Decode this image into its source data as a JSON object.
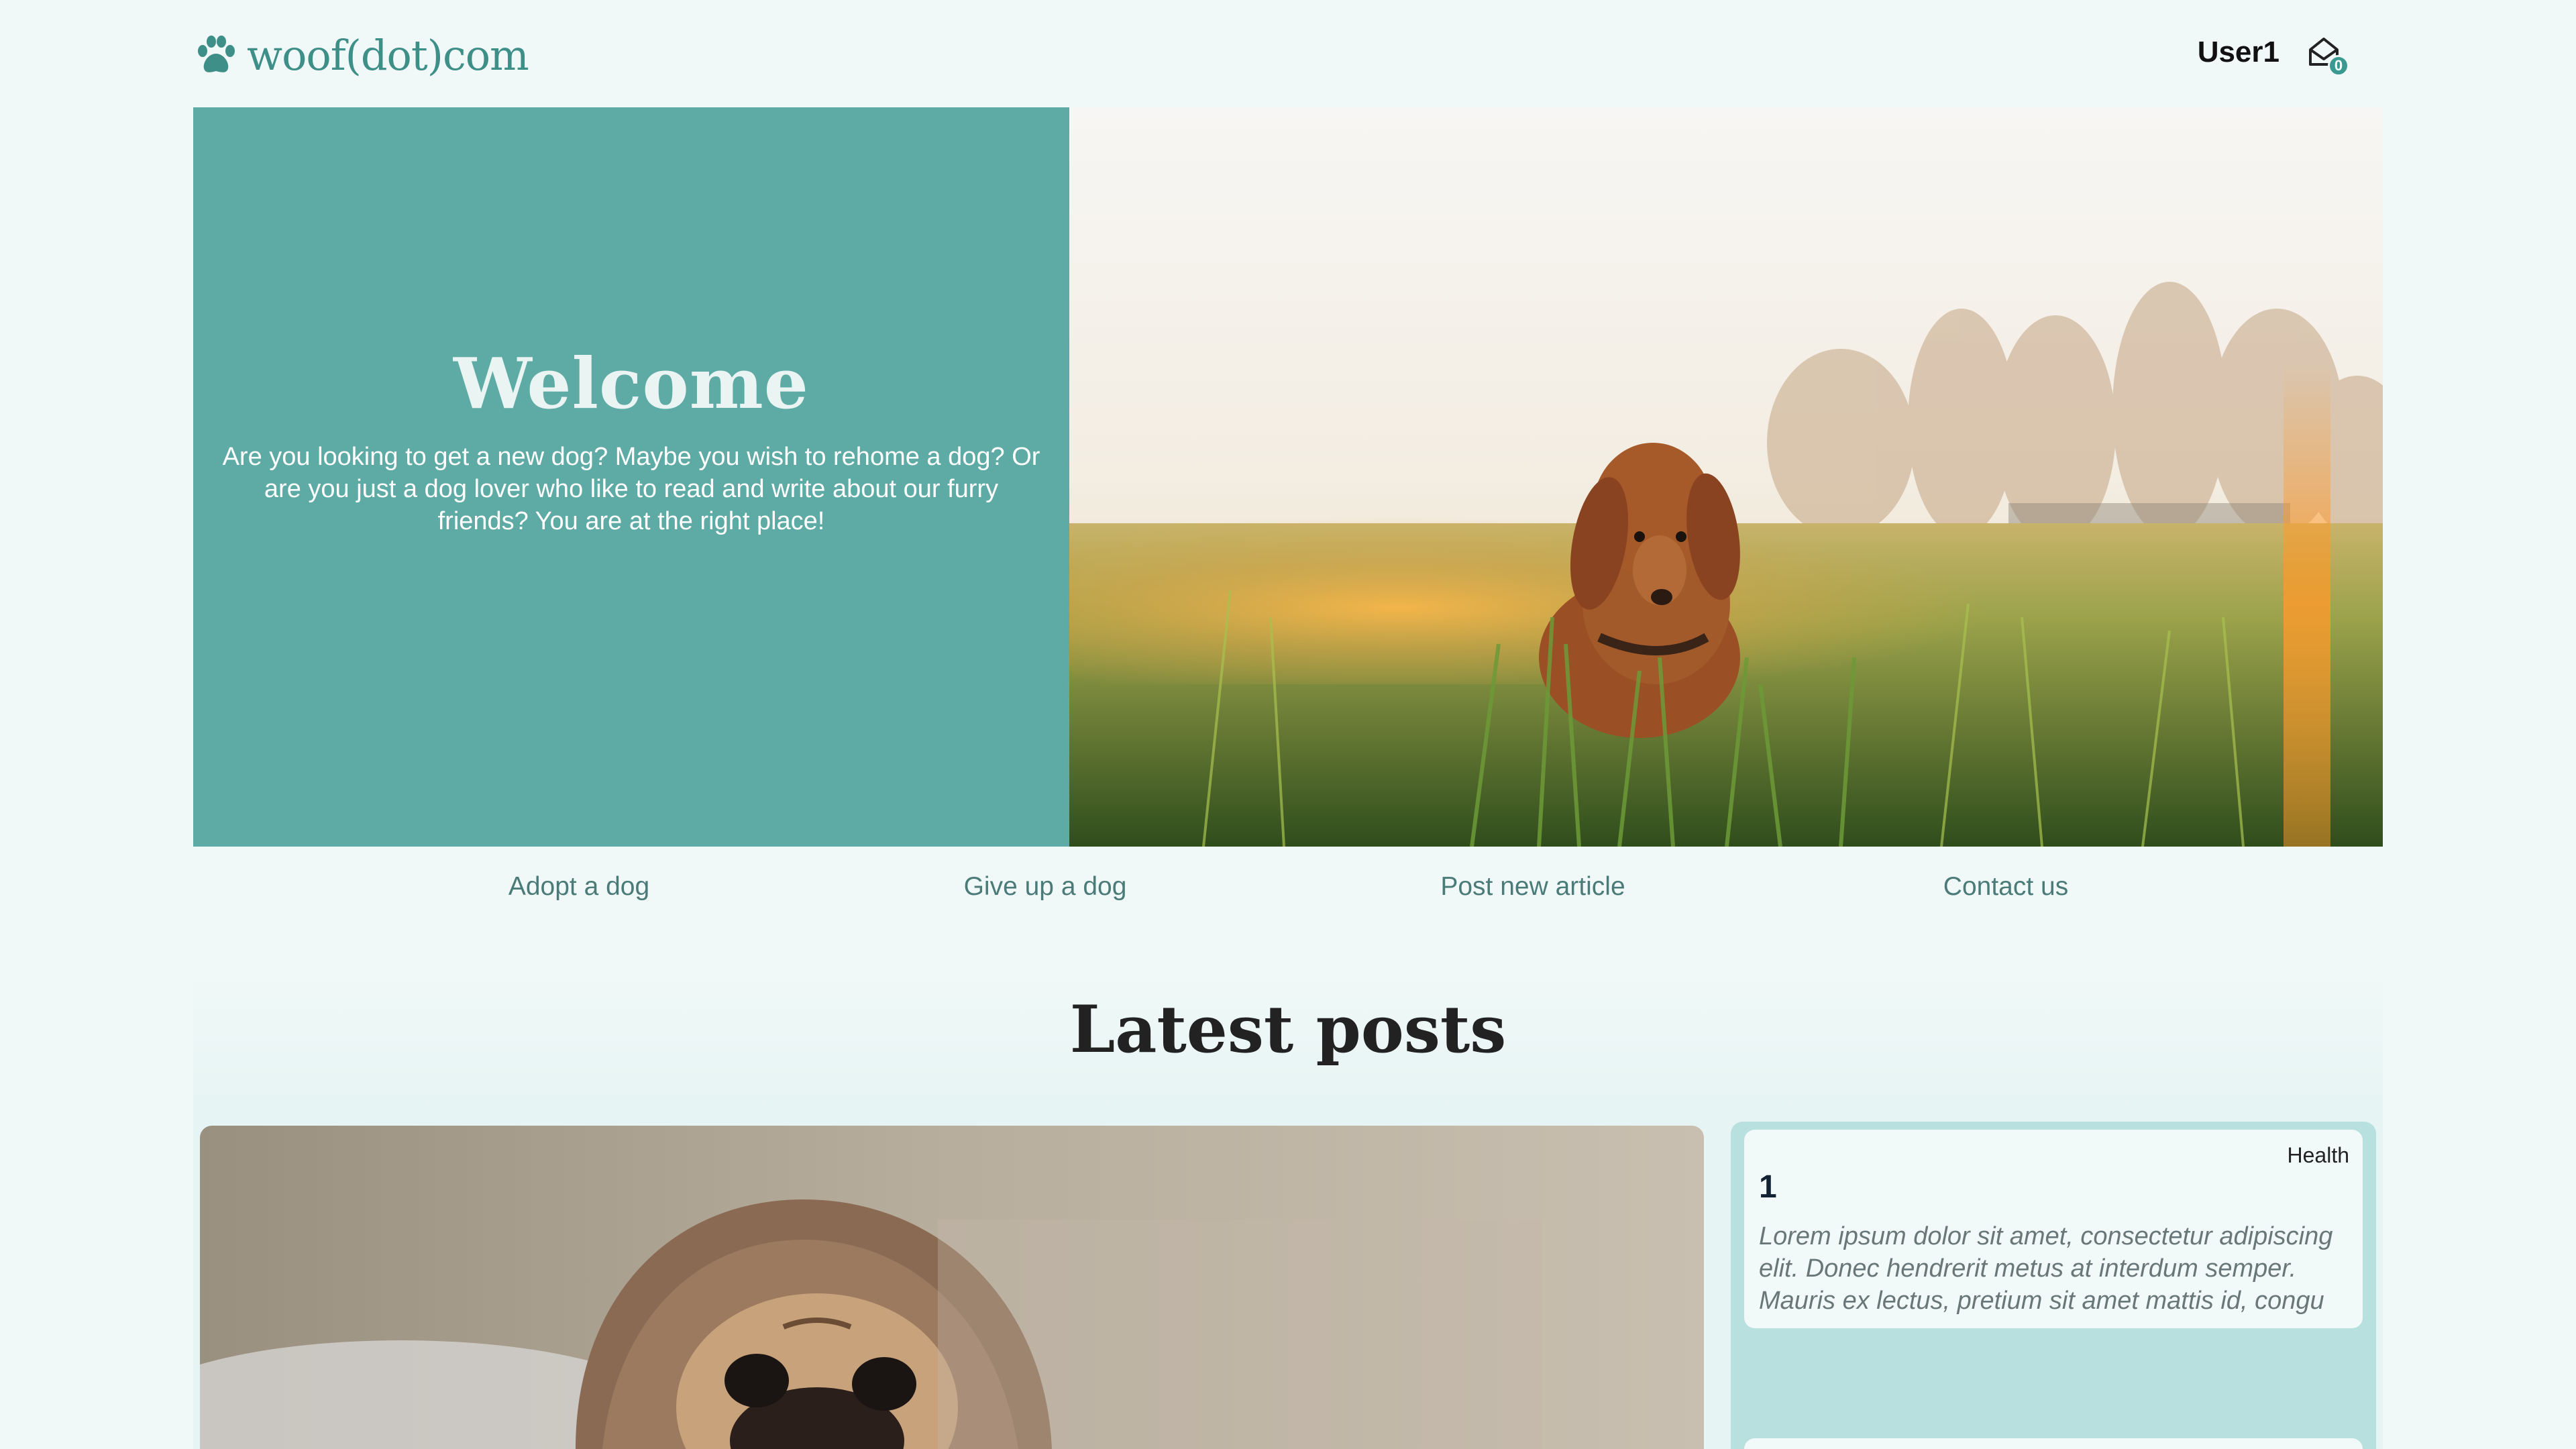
{
  "header": {
    "logo_text": "woof(dot)com",
    "user_name": "User1",
    "mail_count": "0"
  },
  "hero": {
    "title": "Welcome",
    "text": "Are you looking to get a new dog? Maybe you wish to rehome a dog? Or are you just a dog lover who like to read and write about our furry friends? You are at the right place!"
  },
  "nav": {
    "items": [
      {
        "label": "Adopt a dog"
      },
      {
        "label": "Give up a dog"
      },
      {
        "label": "Post new article"
      },
      {
        "label": "Contact us"
      }
    ]
  },
  "posts": {
    "title": "Latest posts",
    "items": [
      {
        "tag": "Health",
        "title": "1",
        "excerpt": "Lorem ipsum dolor sit amet, consectetur adipiscing elit. Donec hendrerit metus at interdum semper. Mauris ex lectus, pretium sit amet mattis id, congu"
      }
    ]
  },
  "colors": {
    "page_bg": "#f1f9f8",
    "accent": "#5eaaa4",
    "side_column": "#b8e0de",
    "nav_text": "#4b7b78"
  },
  "icons": [
    "paw-icon",
    "mail-icon"
  ]
}
